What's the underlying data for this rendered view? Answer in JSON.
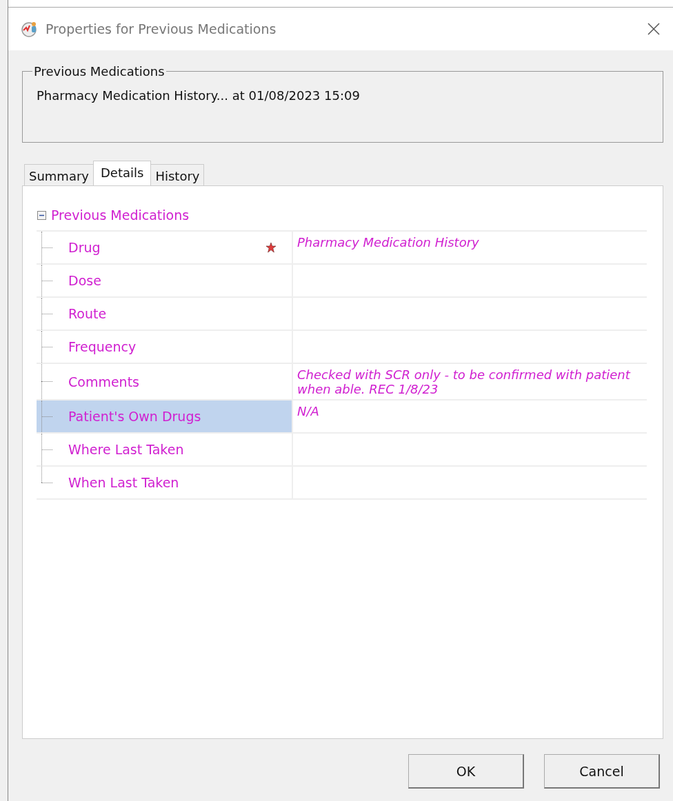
{
  "window": {
    "title": "Properties for Previous Medications"
  },
  "group": {
    "title": "Previous Medications",
    "text": "Pharmacy Medication History... at 01/08/2023 15:09"
  },
  "tabs": [
    {
      "label": "Summary",
      "selected": false
    },
    {
      "label": "Details",
      "selected": true
    },
    {
      "label": "History",
      "selected": false
    }
  ],
  "tree": {
    "label": "Previous Medications",
    "expanded": true,
    "children": [
      {
        "label": "Drug",
        "required": true,
        "selected": false,
        "value": "Pharmacy Medication History"
      },
      {
        "label": "Dose",
        "required": false,
        "selected": false
      },
      {
        "label": "Route",
        "required": false,
        "selected": false
      },
      {
        "label": "Frequency",
        "required": false,
        "selected": false
      },
      {
        "label": "Comments",
        "required": false,
        "selected": false,
        "value": "Checked with SCR only - to be confirmed with patient when able.  REC 1/8/23"
      },
      {
        "label": "Patient's Own Drugs",
        "required": false,
        "selected": true,
        "value": "N/A"
      },
      {
        "label": "Where Last Taken",
        "required": false,
        "selected": false
      },
      {
        "label": "When Last Taken",
        "required": false,
        "selected": false
      }
    ]
  },
  "buttons": [
    "OK",
    "Cancel"
  ]
}
